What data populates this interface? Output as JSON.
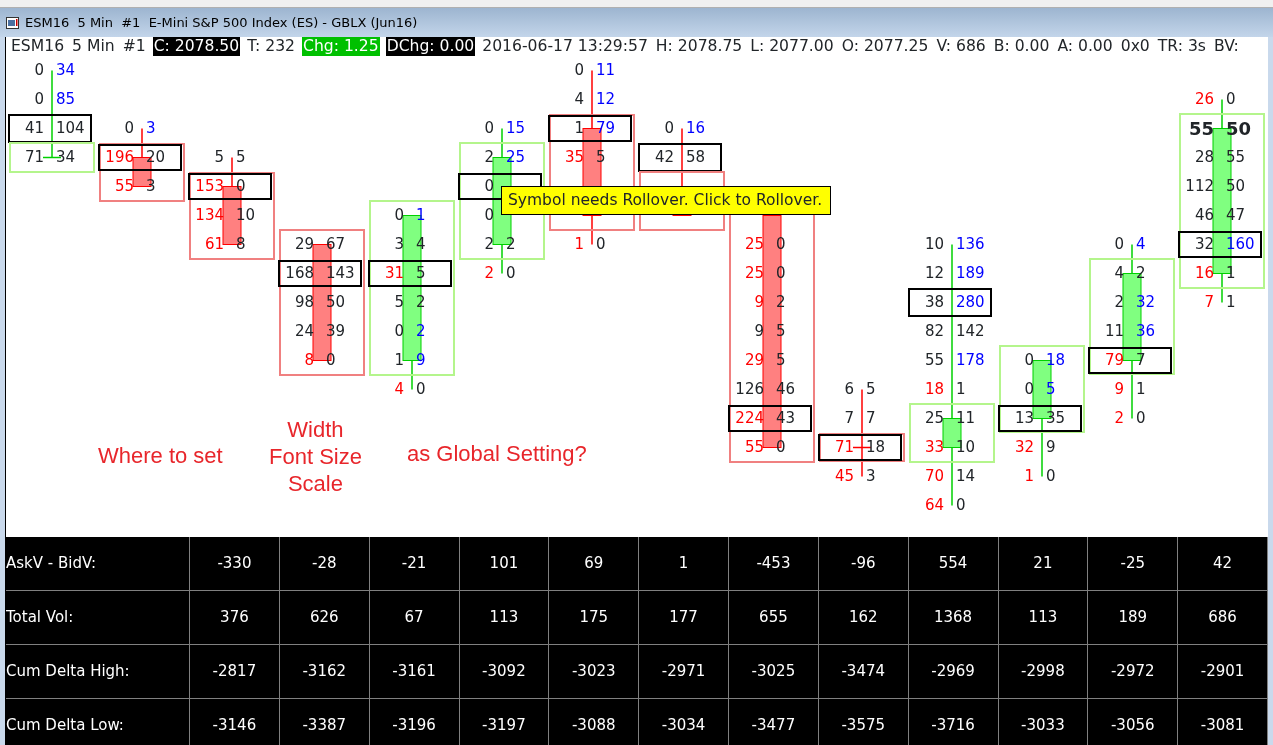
{
  "window": {
    "title": "ESM16  5 Min  #1  E-Mini S&P 500 Index (ES) - GBLX (Jun16)"
  },
  "info_line": [
    {
      "text": "ESM16",
      "kind": "plain"
    },
    {
      "text": "5 Min",
      "kind": "plain"
    },
    {
      "text": "#1",
      "kind": "plain"
    },
    {
      "text": "C: 2078.50",
      "kind": "dark"
    },
    {
      "text": "T: 232",
      "kind": "plain"
    },
    {
      "text": "Chg: 1.25",
      "kind": "green"
    },
    {
      "text": "DChg: 0.00",
      "kind": "dark"
    },
    {
      "text": "2016-06-17 13:29:57",
      "kind": "plain"
    },
    {
      "text": "H: 2078.75",
      "kind": "plain"
    },
    {
      "text": "L: 2077.00",
      "kind": "plain"
    },
    {
      "text": "O: 2077.25",
      "kind": "plain"
    },
    {
      "text": "V: 686",
      "kind": "plain"
    },
    {
      "text": "B: 0.00",
      "kind": "plain"
    },
    {
      "text": "A: 0.00",
      "kind": "plain"
    },
    {
      "text": "0x0",
      "kind": "plain"
    },
    {
      "text": "TR: 3s",
      "kind": "plain"
    },
    {
      "text": "BV:",
      "kind": "plain"
    }
  ],
  "bars": [
    {
      "kind": "up",
      "sections": [
        {
          "kind": "plain",
          "levels": [
            {
              "kind": "cell",
              "bid": "0",
              "ask": "34",
              "bid_imbalance": false,
              "ask_imbalance": true
            },
            {
              "kind": "cell",
              "bid": "0",
              "ask": "85",
              "bid_imbalance": false,
              "ask_imbalance": true
            },
            {
              "kind": "poc",
              "bid": "41",
              "ask": "104",
              "bid_imbalance": false,
              "ask_imbalance": false
            }
          ]
        },
        {
          "kind": "value_area",
          "levels": [
            {
              "kind": "cell",
              "bid": "71",
              "ask": "34",
              "bid_imbalance": false,
              "ask_imbalance": false
            }
          ]
        }
      ]
    },
    {
      "kind": "down",
      "sections": [
        {
          "kind": "plain",
          "levels": [
            {
              "kind": "empty"
            },
            {
              "kind": "empty"
            },
            {
              "kind": "cell",
              "bid": "0",
              "ask": "3",
              "bid_imbalance": false,
              "ask_imbalance": true
            }
          ]
        },
        {
          "kind": "value_area",
          "levels": [
            {
              "kind": "poc",
              "bid": "196",
              "ask": "20",
              "bid_imbalance": true,
              "ask_imbalance": false
            },
            {
              "kind": "cell",
              "bid": "55",
              "ask": "3",
              "bid_imbalance": true,
              "ask_imbalance": false
            }
          ]
        }
      ]
    },
    {
      "kind": "down",
      "sections": [
        {
          "kind": "plain",
          "levels": [
            {
              "kind": "empty"
            },
            {
              "kind": "empty"
            },
            {
              "kind": "empty"
            },
            {
              "kind": "cell",
              "bid": "5",
              "ask": "5",
              "bid_imbalance": false,
              "ask_imbalance": false
            }
          ]
        },
        {
          "kind": "value_area",
          "levels": [
            {
              "kind": "poc",
              "bid": "153",
              "ask": "0",
              "bid_imbalance": true,
              "ask_imbalance": false
            },
            {
              "kind": "cell",
              "bid": "134",
              "ask": "10",
              "bid_imbalance": true,
              "ask_imbalance": false
            },
            {
              "kind": "cell",
              "bid": "61",
              "ask": "8",
              "bid_imbalance": true,
              "ask_imbalance": false
            }
          ]
        }
      ]
    },
    {
      "kind": "down",
      "sections": [
        {
          "kind": "plain",
          "levels": [
            {
              "kind": "empty"
            },
            {
              "kind": "empty"
            },
            {
              "kind": "empty"
            },
            {
              "kind": "empty"
            },
            {
              "kind": "empty"
            },
            {
              "kind": "empty"
            }
          ]
        },
        {
          "kind": "value_area",
          "levels": [
            {
              "kind": "cell",
              "bid": "29",
              "ask": "67",
              "bid_imbalance": false,
              "ask_imbalance": false
            },
            {
              "kind": "poc",
              "bid": "168",
              "ask": "143",
              "bid_imbalance": false,
              "ask_imbalance": false
            },
            {
              "kind": "cell",
              "bid": "98",
              "ask": "50",
              "bid_imbalance": false,
              "ask_imbalance": false
            },
            {
              "kind": "cell",
              "bid": "24",
              "ask": "39",
              "bid_imbalance": false,
              "ask_imbalance": false
            },
            {
              "kind": "cell",
              "bid": "8",
              "ask": "0",
              "bid_imbalance": true,
              "ask_imbalance": false
            }
          ]
        }
      ]
    },
    {
      "kind": "up",
      "sections": [
        {
          "kind": "plain",
          "levels": [
            {
              "kind": "empty"
            },
            {
              "kind": "empty"
            },
            {
              "kind": "empty"
            },
            {
              "kind": "empty"
            },
            {
              "kind": "empty"
            }
          ]
        },
        {
          "kind": "value_area",
          "levels": [
            {
              "kind": "cell",
              "bid": "0",
              "ask": "1",
              "bid_imbalance": false,
              "ask_imbalance": true
            },
            {
              "kind": "cell",
              "bid": "3",
              "ask": "4",
              "bid_imbalance": false,
              "ask_imbalance": false
            },
            {
              "kind": "poc",
              "bid": "31",
              "ask": "5",
              "bid_imbalance": true,
              "ask_imbalance": false
            },
            {
              "kind": "cell",
              "bid": "5",
              "ask": "2",
              "bid_imbalance": false,
              "ask_imbalance": false
            },
            {
              "kind": "cell",
              "bid": "0",
              "ask": "2",
              "bid_imbalance": false,
              "ask_imbalance": true
            },
            {
              "kind": "cell",
              "bid": "1",
              "ask": "9",
              "bid_imbalance": false,
              "ask_imbalance": true
            }
          ]
        },
        {
          "kind": "plain",
          "levels": [
            {
              "kind": "cell",
              "bid": "4",
              "ask": "0",
              "bid_imbalance": true,
              "ask_imbalance": false
            }
          ]
        }
      ]
    },
    {
      "kind": "up",
      "sections": [
        {
          "kind": "plain",
          "levels": [
            {
              "kind": "empty"
            },
            {
              "kind": "empty"
            },
            {
              "kind": "cell",
              "bid": "0",
              "ask": "15",
              "bid_imbalance": false,
              "ask_imbalance": true
            }
          ]
        },
        {
          "kind": "value_area",
          "levels": [
            {
              "kind": "cell",
              "bid": "2",
              "ask": "25",
              "bid_imbalance": false,
              "ask_imbalance": true
            },
            {
              "kind": "poc",
              "bid": "0",
              "bid_imbalance": false
            },
            {
              "kind": "cell",
              "bid": "0",
              "bid_imbalance": false
            },
            {
              "kind": "cell",
              "bid": "2",
              "ask": "2",
              "bid_imbalance": false,
              "ask_imbalance": false
            }
          ]
        },
        {
          "kind": "plain",
          "levels": [
            {
              "kind": "cell",
              "bid": "2",
              "ask": "0",
              "bid_imbalance": true,
              "ask_imbalance": false
            }
          ]
        }
      ]
    },
    {
      "kind": "down",
      "sections": [
        {
          "kind": "plain",
          "levels": [
            {
              "kind": "cell",
              "bid": "0",
              "ask": "11",
              "bid_imbalance": false,
              "ask_imbalance": true
            },
            {
              "kind": "cell",
              "bid": "4",
              "ask": "12",
              "bid_imbalance": false,
              "ask_imbalance": true
            }
          ]
        },
        {
          "kind": "value_area",
          "levels": [
            {
              "kind": "poc",
              "bid": "1",
              "ask": "79",
              "bid_imbalance": false,
              "ask_imbalance": true
            },
            {
              "kind": "cell",
              "bid": "35",
              "ask": "5",
              "bid_imbalance": true,
              "ask_imbalance": false
            },
            {
              "kind": "covered"
            },
            {
              "kind": "covered"
            }
          ]
        },
        {
          "kind": "plain",
          "levels": [
            {
              "kind": "cell",
              "bid": "1",
              "ask": "0",
              "bid_imbalance": true,
              "ask_imbalance": false
            }
          ]
        }
      ]
    },
    {
      "kind": "down",
      "sections": [
        {
          "kind": "plain",
          "levels": [
            {
              "kind": "empty"
            },
            {
              "kind": "empty"
            },
            {
              "kind": "cell",
              "bid": "0",
              "ask": "16",
              "bid_imbalance": false,
              "ask_imbalance": true
            },
            {
              "kind": "poc",
              "bid": "42",
              "ask": "58",
              "bid_imbalance": false,
              "ask_imbalance": false
            }
          ]
        },
        {
          "kind": "value_area",
          "levels": [
            {
              "kind": "covered"
            },
            {
              "kind": "covered"
            }
          ]
        }
      ]
    },
    {
      "kind": "down",
      "sections": [
        {
          "kind": "plain",
          "levels": [
            {
              "kind": "empty"
            },
            {
              "kind": "empty"
            },
            {
              "kind": "empty"
            },
            {
              "kind": "empty"
            },
            {
              "kind": "empty"
            }
          ]
        },
        {
          "kind": "value_area",
          "levels": [
            {
              "kind": "covered"
            },
            {
              "kind": "cell",
              "bid": "25",
              "ask": "0",
              "bid_imbalance": true,
              "ask_imbalance": false
            },
            {
              "kind": "cell",
              "bid": "25",
              "ask": "0",
              "bid_imbalance": true,
              "ask_imbalance": false
            },
            {
              "kind": "cell",
              "bid": "9",
              "ask": "2",
              "bid_imbalance": true,
              "ask_imbalance": false
            },
            {
              "kind": "cell",
              "bid": "9",
              "ask": "5",
              "bid_imbalance": false,
              "ask_imbalance": false
            },
            {
              "kind": "cell",
              "bid": "29",
              "ask": "5",
              "bid_imbalance": true,
              "ask_imbalance": false
            },
            {
              "kind": "cell",
              "bid": "126",
              "ask": "46",
              "bid_imbalance": false,
              "ask_imbalance": false
            },
            {
              "kind": "poc",
              "bid": "224",
              "ask": "43",
              "bid_imbalance": true,
              "ask_imbalance": false
            },
            {
              "kind": "cell",
              "bid": "55",
              "ask": "0",
              "bid_imbalance": true,
              "ask_imbalance": false
            }
          ]
        }
      ]
    },
    {
      "kind": "down",
      "sections": [
        {
          "kind": "plain",
          "levels": [
            {
              "kind": "empty"
            },
            {
              "kind": "empty"
            },
            {
              "kind": "empty"
            },
            {
              "kind": "empty"
            },
            {
              "kind": "empty"
            },
            {
              "kind": "empty"
            },
            {
              "kind": "empty"
            },
            {
              "kind": "empty"
            },
            {
              "kind": "empty"
            },
            {
              "kind": "empty"
            },
            {
              "kind": "empty"
            },
            {
              "kind": "cell",
              "bid": "6",
              "ask": "5",
              "bid_imbalance": false,
              "ask_imbalance": false
            },
            {
              "kind": "cell",
              "bid": "7",
              "ask": "7",
              "bid_imbalance": false,
              "ask_imbalance": false
            }
          ]
        },
        {
          "kind": "value_area",
          "levels": [
            {
              "kind": "poc",
              "bid": "71",
              "ask": "18",
              "bid_imbalance": true,
              "ask_imbalance": false
            }
          ]
        },
        {
          "kind": "plain",
          "levels": [
            {
              "kind": "cell",
              "bid": "45",
              "ask": "3",
              "bid_imbalance": true,
              "ask_imbalance": false
            }
          ]
        }
      ]
    },
    {
      "kind": "up",
      "sections": [
        {
          "kind": "plain",
          "levels": [
            {
              "kind": "empty"
            },
            {
              "kind": "empty"
            },
            {
              "kind": "empty"
            },
            {
              "kind": "empty"
            },
            {
              "kind": "empty"
            },
            {
              "kind": "empty"
            },
            {
              "kind": "cell",
              "bid": "10",
              "ask": "136",
              "bid_imbalance": false,
              "ask_imbalance": true
            },
            {
              "kind": "cell",
              "bid": "12",
              "ask": "189",
              "bid_imbalance": false,
              "ask_imbalance": true
            },
            {
              "kind": "poc",
              "bid": "38",
              "ask": "280",
              "bid_imbalance": false,
              "ask_imbalance": true
            },
            {
              "kind": "cell",
              "bid": "82",
              "ask": "142",
              "bid_imbalance": false,
              "ask_imbalance": false
            },
            {
              "kind": "cell",
              "bid": "55",
              "ask": "178",
              "bid_imbalance": false,
              "ask_imbalance": true
            },
            {
              "kind": "cell",
              "bid": "18",
              "ask": "1",
              "bid_imbalance": true,
              "ask_imbalance": false
            }
          ]
        },
        {
          "kind": "value_area",
          "levels": [
            {
              "kind": "cell",
              "bid": "25",
              "ask": "11",
              "bid_imbalance": false,
              "ask_imbalance": false
            },
            {
              "kind": "cell",
              "bid": "33",
              "ask": "10",
              "bid_imbalance": true,
              "ask_imbalance": false
            }
          ]
        },
        {
          "kind": "plain",
          "levels": [
            {
              "kind": "cell",
              "bid": "70",
              "ask": "14",
              "bid_imbalance": true,
              "ask_imbalance": false
            },
            {
              "kind": "cell",
              "bid": "64",
              "ask": "0",
              "bid_imbalance": true,
              "ask_imbalance": false
            }
          ]
        }
      ]
    },
    {
      "kind": "up",
      "sections": [
        {
          "kind": "plain",
          "levels": [
            {
              "kind": "empty"
            },
            {
              "kind": "empty"
            },
            {
              "kind": "empty"
            },
            {
              "kind": "empty"
            },
            {
              "kind": "empty"
            },
            {
              "kind": "empty"
            },
            {
              "kind": "empty"
            },
            {
              "kind": "empty"
            },
            {
              "kind": "empty"
            },
            {
              "kind": "empty"
            }
          ]
        },
        {
          "kind": "value_area",
          "levels": [
            {
              "kind": "cell",
              "bid": "0",
              "ask": "18",
              "bid_imbalance": false,
              "ask_imbalance": true
            },
            {
              "kind": "cell",
              "bid": "0",
              "ask": "5",
              "bid_imbalance": false,
              "ask_imbalance": true
            },
            {
              "kind": "poc",
              "bid": "13",
              "ask": "35",
              "bid_imbalance": false,
              "ask_imbalance": false
            }
          ]
        },
        {
          "kind": "plain",
          "levels": [
            {
              "kind": "cell",
              "bid": "32",
              "ask": "9",
              "bid_imbalance": true,
              "ask_imbalance": false
            },
            {
              "kind": "cell",
              "bid": "1",
              "ask": "0",
              "bid_imbalance": true,
              "ask_imbalance": false
            }
          ]
        }
      ]
    },
    {
      "kind": "up",
      "sections": [
        {
          "kind": "plain",
          "levels": [
            {
              "kind": "empty"
            },
            {
              "kind": "empty"
            },
            {
              "kind": "empty"
            },
            {
              "kind": "empty"
            },
            {
              "kind": "empty"
            },
            {
              "kind": "empty"
            },
            {
              "kind": "cell",
              "bid": "0",
              "ask": "4",
              "bid_imbalance": false,
              "ask_imbalance": true
            }
          ]
        },
        {
          "kind": "value_area",
          "levels": [
            {
              "kind": "cell",
              "bid": "4",
              "ask": "2",
              "bid_imbalance": false,
              "ask_imbalance": false
            },
            {
              "kind": "cell",
              "bid": "2",
              "ask": "32",
              "bid_imbalance": false,
              "ask_imbalance": true
            },
            {
              "kind": "cell",
              "bid": "11",
              "ask": "36",
              "bid_imbalance": false,
              "ask_imbalance": true
            },
            {
              "kind": "poc",
              "bid": "79",
              "ask": "7",
              "bid_imbalance": true,
              "ask_imbalance": false
            }
          ]
        },
        {
          "kind": "plain",
          "levels": [
            {
              "kind": "cell",
              "bid": "9",
              "ask": "1",
              "bid_imbalance": true,
              "ask_imbalance": false
            },
            {
              "kind": "cell",
              "bid": "2",
              "ask": "0",
              "bid_imbalance": true,
              "ask_imbalance": false
            }
          ]
        }
      ]
    },
    {
      "kind": "up",
      "sections": [
        {
          "kind": "plain",
          "levels": [
            {
              "kind": "empty"
            },
            {
              "kind": "cell",
              "bid": "26",
              "ask": "0",
              "bid_imbalance": true,
              "ask_imbalance": false
            }
          ]
        },
        {
          "kind": "value_area",
          "levels": [
            {
              "kind": "current",
              "bid": "55",
              "ask": "50",
              "bid_imbalance": false,
              "ask_imbalance": false
            },
            {
              "kind": "cell",
              "bid": "28",
              "ask": "55",
              "bid_imbalance": false,
              "ask_imbalance": false
            },
            {
              "kind": "cell",
              "bid": "112",
              "ask": "50",
              "bid_imbalance": false,
              "ask_imbalance": false
            },
            {
              "kind": "cell",
              "bid": "46",
              "ask": "47",
              "bid_imbalance": false,
              "ask_imbalance": false
            },
            {
              "kind": "poc",
              "bid": "32",
              "ask": "160",
              "bid_imbalance": false,
              "ask_imbalance": true
            },
            {
              "kind": "cell",
              "bid": "16",
              "ask": "1",
              "bid_imbalance": true,
              "ask_imbalance": false
            }
          ]
        },
        {
          "kind": "plain",
          "levels": [
            {
              "kind": "cell",
              "bid": "7",
              "ask": "1",
              "bid_imbalance": true,
              "ask_imbalance": false
            }
          ]
        }
      ]
    }
  ],
  "annotations": [
    {
      "lines": [
        "Where to set"
      ]
    },
    {
      "lines": [
        "Width",
        "Font Size",
        "Scale"
      ]
    },
    {
      "lines": [
        "as Global Setting?"
      ]
    }
  ],
  "tooltip": {
    "text": "Symbol needs Rollover. Click to Rollover."
  },
  "stats_table": [
    {
      "label": "AskV - BidV:",
      "values": [
        "-330",
        "-28",
        "-21",
        "101",
        "69",
        "1",
        "-453",
        "-96",
        "554",
        "21",
        "-25",
        "42"
      ]
    },
    {
      "label": "Total Vol:",
      "values": [
        "376",
        "626",
        "67",
        "113",
        "175",
        "177",
        "655",
        "162",
        "1368",
        "113",
        "189",
        "686"
      ]
    },
    {
      "label": "Cum Delta High:",
      "values": [
        "-2817",
        "-3162",
        "-3161",
        "-3092",
        "-3023",
        "-2971",
        "-3025",
        "-3474",
        "-2969",
        "-2998",
        "-2972",
        "-2901"
      ]
    },
    {
      "label": "Cum Delta Low:",
      "values": [
        "-3146",
        "-3387",
        "-3196",
        "-3197",
        "-3088",
        "-3034",
        "-3477",
        "-3575",
        "-3716",
        "-3033",
        "-3056",
        "-3081"
      ]
    }
  ]
}
